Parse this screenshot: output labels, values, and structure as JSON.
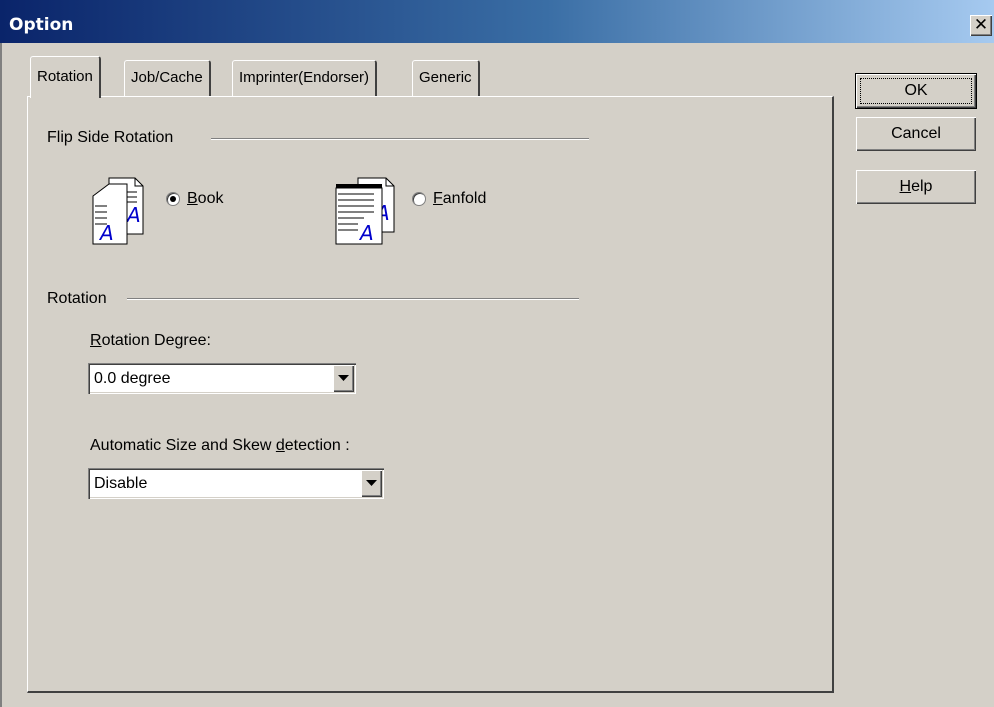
{
  "window": {
    "title": "Option",
    "close_label": "✕"
  },
  "tabs": [
    {
      "label": "Rotation",
      "active": true
    },
    {
      "label": "Job/Cache",
      "active": false
    },
    {
      "label": "Imprinter(Endorser)",
      "active": false
    },
    {
      "label": "Generic",
      "active": false
    }
  ],
  "flip_side": {
    "group_label": "Flip Side Rotation",
    "options": [
      {
        "access_key": "B",
        "label_rest": "ook",
        "selected": true,
        "icon": "book-pages-icon"
      },
      {
        "access_key": "F",
        "label_rest": "anfold",
        "selected": false,
        "icon": "fanfold-pages-icon"
      }
    ]
  },
  "rotation": {
    "group_label": "Rotation",
    "degree_label_key": "R",
    "degree_label_rest": "otation Degree:",
    "degree_value": "0.0 degree",
    "detect_label_pre": "Automatic Size and Skew ",
    "detect_label_key": "d",
    "detect_label_post": "etection :",
    "detect_value": "Disable"
  },
  "buttons": {
    "ok": "OK",
    "cancel": "Cancel",
    "help_key": "H",
    "help_rest": "elp"
  }
}
